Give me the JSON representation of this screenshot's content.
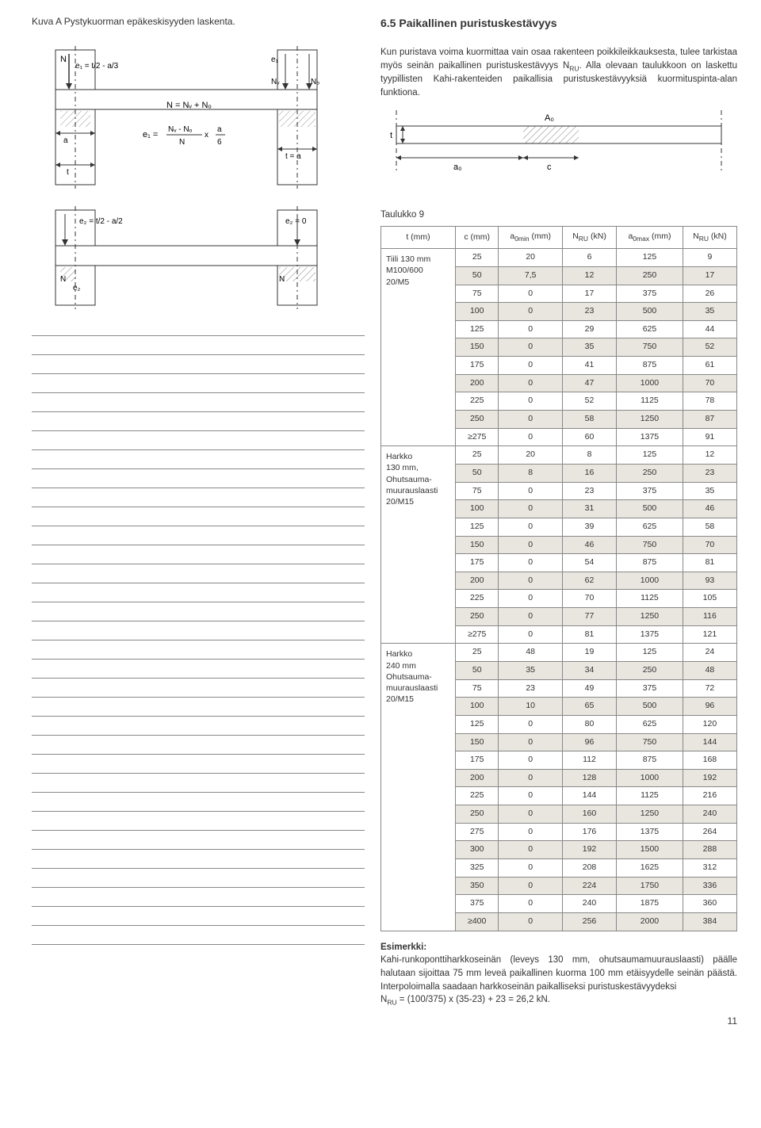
{
  "caption": "Kuva A Pystykuorman epäkeskisyyden laskenta.",
  "section_heading": "6.5 Paikallinen puristuskestävyys",
  "intro_p1": "Kun puristava voima kuormittaa vain osaa rakenteen poikkileikkauksesta, tulee tarkistaa myös seinän paikallinen puristuskestävyys N",
  "intro_sub1": "RU",
  "intro_p1b": ". Alla olevaan taulukkoon on laskettu tyypillisten Kahi-rakenteiden paikallisia puristuskestävyyksiä kuormituspinta-alan funktiona.",
  "diagram_top": {
    "N": "N",
    "e1_label": "e₁ = t/2 - a/3",
    "e1_right": "e₁",
    "NV": "Nᵥ",
    "NO": "Nₒ",
    "N_eq": "N = Nᵥ + Nₒ",
    "e1_eq_left": "e₁ =",
    "e1_eq_num": "Nᵥ - Nₒ",
    "e1_eq_den": "N",
    "e1_eq_x": " x ",
    "e1_eq_num2": "a",
    "e1_eq_den2": "6",
    "a": "a",
    "t": "t",
    "t_eq_a": "t = a"
  },
  "diagram_bottom": {
    "e2_label": "e₂ = t/2 - a/2",
    "e2": "e₂",
    "N": "N",
    "e2_0": "e₂ = 0",
    "N_right": "N"
  },
  "diagram_beam": {
    "t": "t",
    "a0": "a₀",
    "A0": "A₀",
    "c": "c"
  },
  "table_caption": "Taulukko 9",
  "headers": {
    "t": "t (mm)",
    "c": "c (mm)",
    "a0min_pre": "a",
    "a0min_sub": "0min",
    "a0min_post": " (mm)",
    "nru1_pre": "N",
    "nru1_sub": "RU",
    "nru1_post": " (kN)",
    "a0max_pre": "a",
    "a0max_sub": "0max",
    "a0max_post": " (mm)",
    "nru2_pre": "N",
    "nru2_sub": "RU",
    "nru2_post": " (kN)"
  },
  "groups": [
    {
      "label": "Tiili 130 mm\nM100/600\n20/M5",
      "rows": [
        [
          "25",
          "20",
          "6",
          "125",
          "9"
        ],
        [
          "50",
          "7,5",
          "12",
          "250",
          "17"
        ],
        [
          "75",
          "0",
          "17",
          "375",
          "26"
        ],
        [
          "100",
          "0",
          "23",
          "500",
          "35"
        ],
        [
          "125",
          "0",
          "29",
          "625",
          "44"
        ],
        [
          "150",
          "0",
          "35",
          "750",
          "52"
        ],
        [
          "175",
          "0",
          "41",
          "875",
          "61"
        ],
        [
          "200",
          "0",
          "47",
          "1000",
          "70"
        ],
        [
          "225",
          "0",
          "52",
          "1125",
          "78"
        ],
        [
          "250",
          "0",
          "58",
          "1250",
          "87"
        ],
        [
          "≥275",
          "0",
          "60",
          "1375",
          "91"
        ]
      ]
    },
    {
      "label": "Harkko\n130 mm,\nOhutsauma-\nmuurauslaasti\n20/M15",
      "rows": [
        [
          "25",
          "20",
          "8",
          "125",
          "12"
        ],
        [
          "50",
          "8",
          "16",
          "250",
          "23"
        ],
        [
          "75",
          "0",
          "23",
          "375",
          "35"
        ],
        [
          "100",
          "0",
          "31",
          "500",
          "46"
        ],
        [
          "125",
          "0",
          "39",
          "625",
          "58"
        ],
        [
          "150",
          "0",
          "46",
          "750",
          "70"
        ],
        [
          "175",
          "0",
          "54",
          "875",
          "81"
        ],
        [
          "200",
          "0",
          "62",
          "1000",
          "93"
        ],
        [
          "225",
          "0",
          "70",
          "1125",
          "105"
        ],
        [
          "250",
          "0",
          "77",
          "1250",
          "116"
        ],
        [
          "≥275",
          "0",
          "81",
          "1375",
          "121"
        ]
      ]
    },
    {
      "label": "Harkko\n240 mm\nOhutsauma-\nmuurauslaasti\n20/M15",
      "rows": [
        [
          "25",
          "48",
          "19",
          "125",
          "24"
        ],
        [
          "50",
          "35",
          "34",
          "250",
          "48"
        ],
        [
          "75",
          "23",
          "49",
          "375",
          "72"
        ],
        [
          "100",
          "10",
          "65",
          "500",
          "96"
        ],
        [
          "125",
          "0",
          "80",
          "625",
          "120"
        ],
        [
          "150",
          "0",
          "96",
          "750",
          "144"
        ],
        [
          "175",
          "0",
          "112",
          "875",
          "168"
        ],
        [
          "200",
          "0",
          "128",
          "1000",
          "192"
        ],
        [
          "225",
          "0",
          "144",
          "1125",
          "216"
        ],
        [
          "250",
          "0",
          "160",
          "1250",
          "240"
        ],
        [
          "275",
          "0",
          "176",
          "1375",
          "264"
        ],
        [
          "300",
          "0",
          "192",
          "1500",
          "288"
        ],
        [
          "325",
          "0",
          "208",
          "1625",
          "312"
        ],
        [
          "350",
          "0",
          "224",
          "1750",
          "336"
        ],
        [
          "375",
          "0",
          "240",
          "1875",
          "360"
        ],
        [
          "≥400",
          "0",
          "256",
          "2000",
          "384"
        ]
      ]
    }
  ],
  "example": {
    "title": "Esimerkki:",
    "body_1": "Kahi-runkoponttiharkkoseinän (leveys 130 mm, ohutsaumamuurauslaasti) päälle halutaan sijoittaa 75 mm leveä paikallinen kuorma 100 mm etäisyydelle seinän päästä. Interpoloimalla saadaan harkkoseinän paikalliseksi puristuskestävyydeksi",
    "body_2_pre": "N",
    "body_2_sub": "RU",
    "body_2_post": " = (100/375) x (35-23) + 23 = 26,2 kN."
  },
  "page_number": "11",
  "chart_data": {
    "type": "table",
    "title": "Taulukko 9 – Paikallinen puristuskestävyys",
    "columns": [
      "t (mm)",
      "c (mm)",
      "a0min (mm)",
      "NRU (kN)",
      "a0max (mm)",
      "NRU (kN)"
    ],
    "series": [
      {
        "name": "Tiili 130 mm M100/600 20/M5",
        "rows": [
          [
            25,
            20,
            6,
            125,
            9
          ],
          [
            50,
            7.5,
            12,
            250,
            17
          ],
          [
            75,
            0,
            17,
            375,
            26
          ],
          [
            100,
            0,
            23,
            500,
            35
          ],
          [
            125,
            0,
            29,
            625,
            44
          ],
          [
            150,
            0,
            35,
            750,
            52
          ],
          [
            175,
            0,
            41,
            875,
            61
          ],
          [
            200,
            0,
            47,
            1000,
            70
          ],
          [
            225,
            0,
            52,
            1125,
            78
          ],
          [
            250,
            0,
            58,
            1250,
            87
          ],
          [
            "≥275",
            0,
            60,
            1375,
            91
          ]
        ]
      },
      {
        "name": "Harkko 130 mm, Ohutsaumamuurauslaasti 20/M15",
        "rows": [
          [
            25,
            20,
            8,
            125,
            12
          ],
          [
            50,
            8,
            16,
            250,
            23
          ],
          [
            75,
            0,
            23,
            375,
            35
          ],
          [
            100,
            0,
            31,
            500,
            46
          ],
          [
            125,
            0,
            39,
            625,
            58
          ],
          [
            150,
            0,
            46,
            750,
            70
          ],
          [
            175,
            0,
            54,
            875,
            81
          ],
          [
            200,
            0,
            62,
            1000,
            93
          ],
          [
            225,
            0,
            70,
            1125,
            105
          ],
          [
            250,
            0,
            77,
            1250,
            116
          ],
          [
            "≥275",
            0,
            81,
            1375,
            121
          ]
        ]
      },
      {
        "name": "Harkko 240 mm Ohutsaumamuurauslaasti 20/M15",
        "rows": [
          [
            25,
            48,
            19,
            125,
            24
          ],
          [
            50,
            35,
            34,
            250,
            48
          ],
          [
            75,
            23,
            49,
            375,
            72
          ],
          [
            100,
            10,
            65,
            500,
            96
          ],
          [
            125,
            0,
            80,
            625,
            120
          ],
          [
            150,
            0,
            96,
            750,
            144
          ],
          [
            175,
            0,
            112,
            875,
            168
          ],
          [
            200,
            0,
            128,
            1000,
            192
          ],
          [
            225,
            0,
            144,
            1125,
            216
          ],
          [
            250,
            0,
            160,
            1250,
            240
          ],
          [
            275,
            0,
            176,
            1375,
            264
          ],
          [
            300,
            0,
            192,
            1500,
            288
          ],
          [
            325,
            0,
            208,
            1625,
            312
          ],
          [
            350,
            0,
            224,
            1750,
            336
          ],
          [
            375,
            0,
            240,
            1875,
            360
          ],
          [
            "≥400",
            0,
            256,
            2000,
            384
          ]
        ]
      }
    ]
  }
}
